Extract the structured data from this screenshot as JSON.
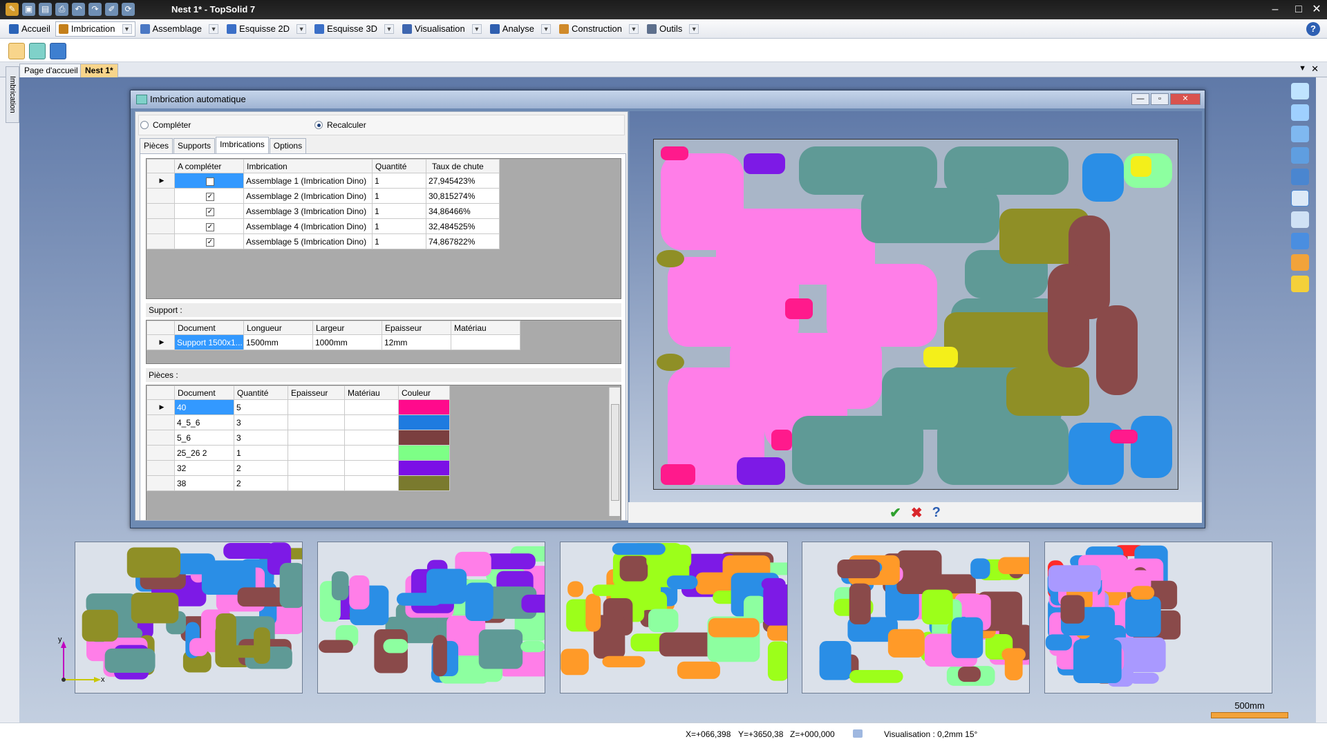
{
  "window": {
    "title": "Nest 1* - TopSolid 7"
  },
  "ribbon_tabs": [
    {
      "label": "Accueil",
      "color": "#2a63b8"
    },
    {
      "label": "Imbrication",
      "color": "#c47f1a"
    },
    {
      "label": "Assemblage",
      "color": "#4b78c4"
    },
    {
      "label": "Esquisse 2D",
      "color": "#3b6fc7"
    },
    {
      "label": "Esquisse 3D",
      "color": "#3b6fc7"
    },
    {
      "label": "Visualisation",
      "color": "#3e66b0"
    },
    {
      "label": "Analyse",
      "color": "#2f5fb0"
    },
    {
      "label": "Construction",
      "color": "#d08a2a"
    },
    {
      "label": "Outils",
      "color": "#5d6f8c"
    }
  ],
  "doc_tabs": {
    "home": "Page d'accueil",
    "nest": "Nest 1*"
  },
  "side_panel": {
    "label": "Imbrication"
  },
  "dialog": {
    "title": "Imbrication automatique",
    "radio_complete": "Compléter",
    "radio_recalc": "Recalculer",
    "tabs": [
      "Pièces",
      "Supports",
      "Imbrications",
      "Options"
    ],
    "nest_grid": {
      "headers": [
        "A compléter",
        "Imbrication",
        "Quantité",
        "Taux de chute"
      ],
      "rows": [
        {
          "name": "Assemblage 1 (Imbrication Dino)",
          "qty": "1",
          "rate": "27,945423%"
        },
        {
          "name": "Assemblage 2 (Imbrication Dino)",
          "qty": "1",
          "rate": "30,815274%"
        },
        {
          "name": "Assemblage 3 (Imbrication Dino)",
          "qty": "1",
          "rate": "34,86466%"
        },
        {
          "name": "Assemblage 4 (Imbrication Dino)",
          "qty": "1",
          "rate": "32,484525%"
        },
        {
          "name": "Assemblage 5 (Imbrication Dino)",
          "qty": "1",
          "rate": "74,867822%"
        }
      ]
    },
    "support_label": "Support :",
    "support_grid": {
      "headers": [
        "Document",
        "Longueur",
        "Largeur",
        "Epaisseur",
        "Matériau"
      ],
      "row": {
        "document": "Support 1500x1...",
        "length": "1500mm",
        "width": "1000mm",
        "thickness": "12mm",
        "material": ""
      }
    },
    "pieces_label": "Pièces :",
    "pieces_grid": {
      "headers": [
        "Document",
        "Quantité",
        "Epaisseur",
        "Matériau",
        "Couleur"
      ],
      "rows": [
        {
          "doc": "40",
          "qty": "5",
          "color": "#ff0a8c"
        },
        {
          "doc": "4_5_6",
          "qty": "3",
          "color": "#1e7be0"
        },
        {
          "doc": "5_6",
          "qty": "3",
          "color": "#7b3f3f"
        },
        {
          "doc": "25_26 2",
          "qty": "1",
          "color": "#7dff86"
        },
        {
          "doc": "32",
          "qty": "2",
          "color": "#7b10e6"
        },
        {
          "doc": "38",
          "qty": "2",
          "color": "#7a7a2e"
        }
      ]
    }
  },
  "status": {
    "x": "X=+066,398",
    "y": "Y=+3650,38",
    "z": "Z=+000,000",
    "visual": "Visualisation : 0,2mm 15°"
  },
  "scale_label": "500mm",
  "axes": {
    "x": "x",
    "y": "y"
  },
  "nest_colors": {
    "pink": "#ff7ee8",
    "teal": "#5f9a96",
    "olive": "#8f8f26",
    "brown": "#8a4a4a",
    "blue": "#2a8ee6",
    "purple": "#7d1ae6",
    "yellow": "#f4ef1a",
    "magenta": "#ff1a8c",
    "lightgreen": "#8dffa0",
    "lime": "#9cff1a",
    "orange": "#ff9a28",
    "red": "#ff2a2a",
    "lilac": "#a999ff"
  }
}
